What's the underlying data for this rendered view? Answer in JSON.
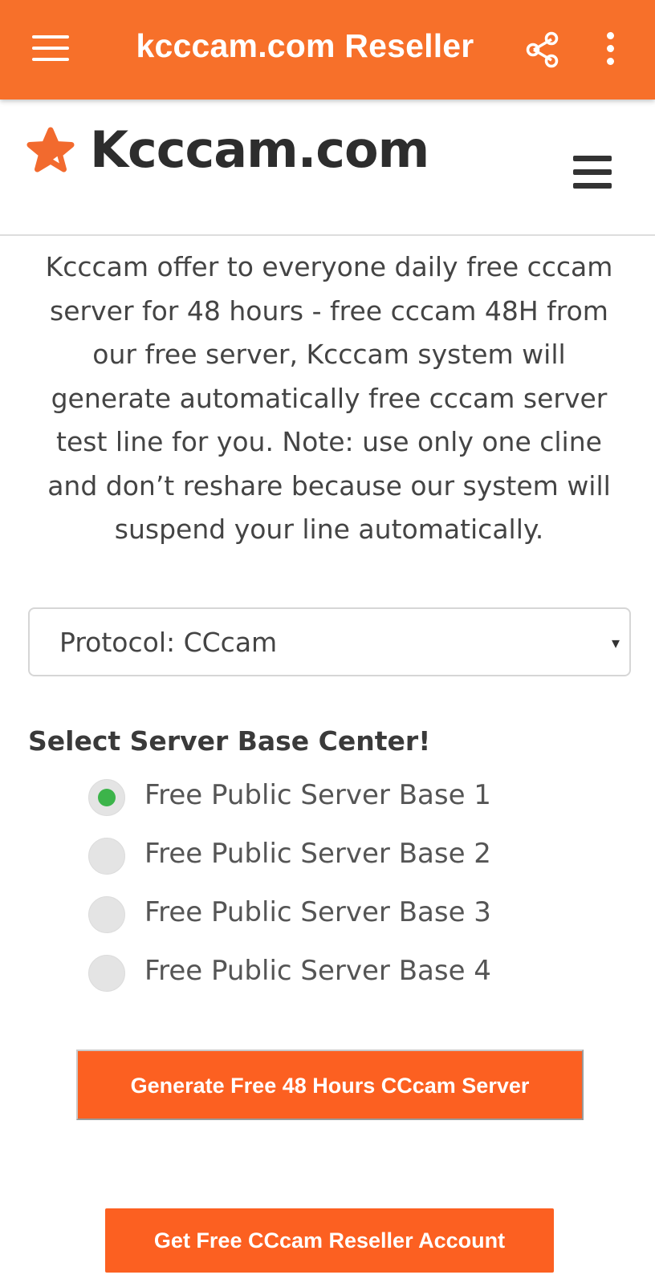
{
  "colors": {
    "app_bar": "#f7702a",
    "button": "#fc6021",
    "radio_checked": "#3cb44a",
    "logo_star": "#f26a2e"
  },
  "app_bar": {
    "title": "kcccam.com Reseller",
    "menu_icon": "hamburger-menu-icon",
    "share_icon": "share-icon",
    "more_icon": "more-vertical-icon"
  },
  "site_header": {
    "logo_text": "Kcccam.com",
    "logo_icon": "star-icon",
    "menu_icon": "hamburger-menu-icon"
  },
  "intro_text": "Kcccam offer to everyone daily free cccam server for 48 hours - free cccam 48H from our free server, Kcccam system will generate automatically free cccam server test line for you. Note: use only one cline and don’t reshare because our system will suspend your line automatically.",
  "protocol_select": {
    "selected": "Protocol: CCcam",
    "arrow": "▾"
  },
  "server_section": {
    "title": "Select Server Base Center!",
    "options": [
      {
        "label": "Free Public Server Base 1",
        "checked": true
      },
      {
        "label": "Free Public Server Base 2",
        "checked": false
      },
      {
        "label": "Free Public Server Base 3",
        "checked": false
      },
      {
        "label": "Free Public Server Base 4",
        "checked": false
      }
    ]
  },
  "buttons": {
    "generate": "Generate Free 48 Hours CCcam Server",
    "reseller": "Get Free CCcam Reseller Account"
  }
}
